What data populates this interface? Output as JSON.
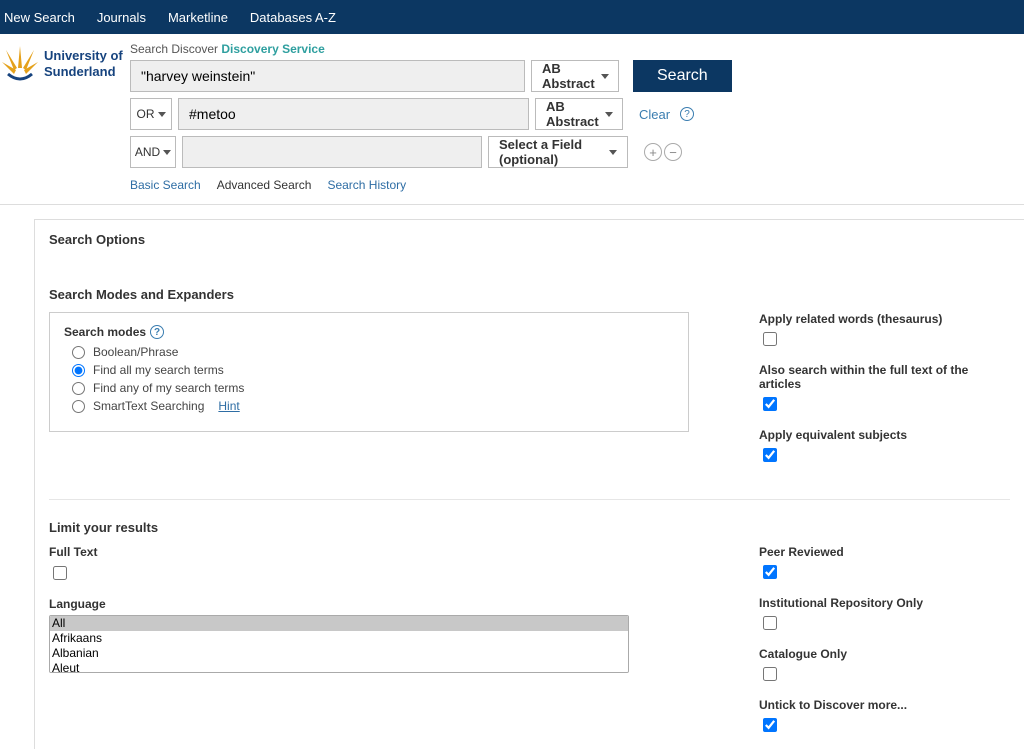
{
  "topnav": {
    "new_search": "New Search",
    "journals": "Journals",
    "marketline": "Marketline",
    "databases": "Databases A-Z"
  },
  "brand": {
    "line1": "University of",
    "line2": "Sunderland"
  },
  "breadcrumb": {
    "prefix": "Search Discover ",
    "service": "Discovery Service"
  },
  "search": {
    "row1": {
      "term": "\"harvey weinstein\"",
      "field": "AB Abstract"
    },
    "row2": {
      "bool": "OR",
      "term": "#metoo",
      "field": "AB Abstract"
    },
    "row3": {
      "bool": "AND",
      "term": "",
      "field": "Select a Field (optional)"
    },
    "search_button": "Search",
    "clear": "Clear"
  },
  "modes_links": {
    "basic": "Basic Search",
    "advanced": "Advanced Search",
    "history": "Search History"
  },
  "options": {
    "panel_title": "Search Options",
    "section1_title": "Search Modes and Expanders",
    "search_modes_label": "Search modes",
    "modes": {
      "boolean": "Boolean/Phrase",
      "all": "Find all my search terms",
      "any": "Find any of my search terms",
      "smart": "SmartText Searching",
      "hint": "Hint"
    },
    "expanders": {
      "related": "Apply related words (thesaurus)",
      "fulltext": "Also search within the full text of the articles",
      "equiv": "Apply equivalent subjects"
    },
    "section2_title": "Limit your results",
    "limits_left": {
      "fulltext": "Full Text",
      "language": "Language",
      "lang_options": [
        "All",
        "Afrikaans",
        "Albanian",
        "Aleut"
      ]
    },
    "limits_right": {
      "peer": "Peer Reviewed",
      "inst": "Institutional Repository Only",
      "catalogue": "Catalogue Only",
      "untick": "Untick to Discover more..."
    }
  }
}
